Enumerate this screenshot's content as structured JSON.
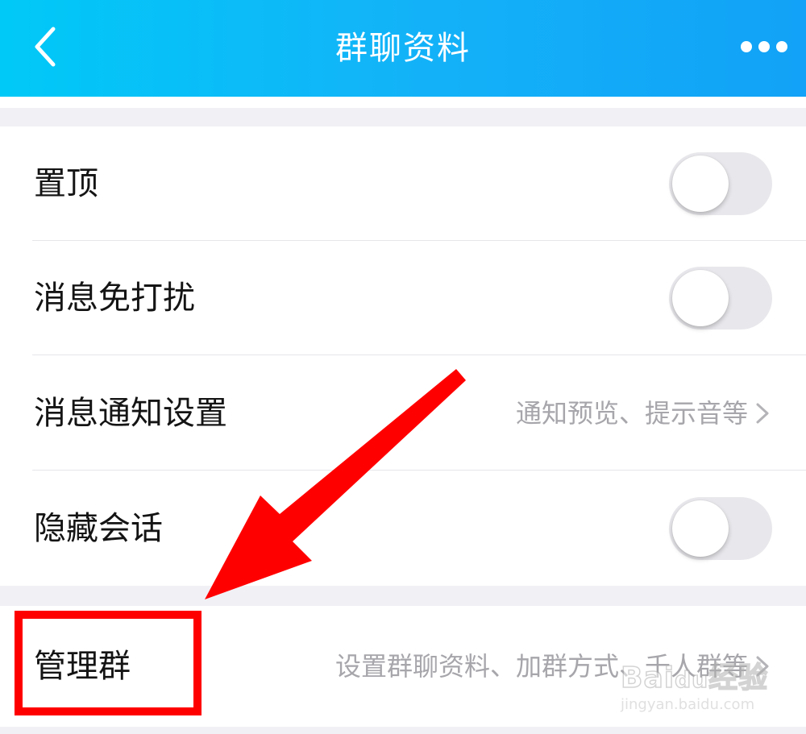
{
  "header": {
    "title": "群聊资料",
    "back_icon": "chevron-left-icon",
    "more_icon": "more-dots-icon",
    "gradient_colors": [
      "#00c9f7",
      "#12a2f7"
    ]
  },
  "settings": {
    "pin": {
      "label": "置顶",
      "toggle_on": false
    },
    "mute": {
      "label": "消息免打扰",
      "toggle_on": false
    },
    "notify": {
      "label": "消息通知设置",
      "detail": "通知预览、提示音等"
    },
    "hide": {
      "label": "隐藏会话",
      "toggle_on": false
    }
  },
  "manage": {
    "label": "管理群",
    "detail": "设置群聊资料、加群方式、千人群等"
  },
  "annotation": {
    "color": "#ff0000",
    "highlight": "red-box",
    "pointer": "red-arrow"
  },
  "watermark": {
    "logo_lettering": "Baidu经验",
    "url": "jingyan.baidu.com"
  }
}
